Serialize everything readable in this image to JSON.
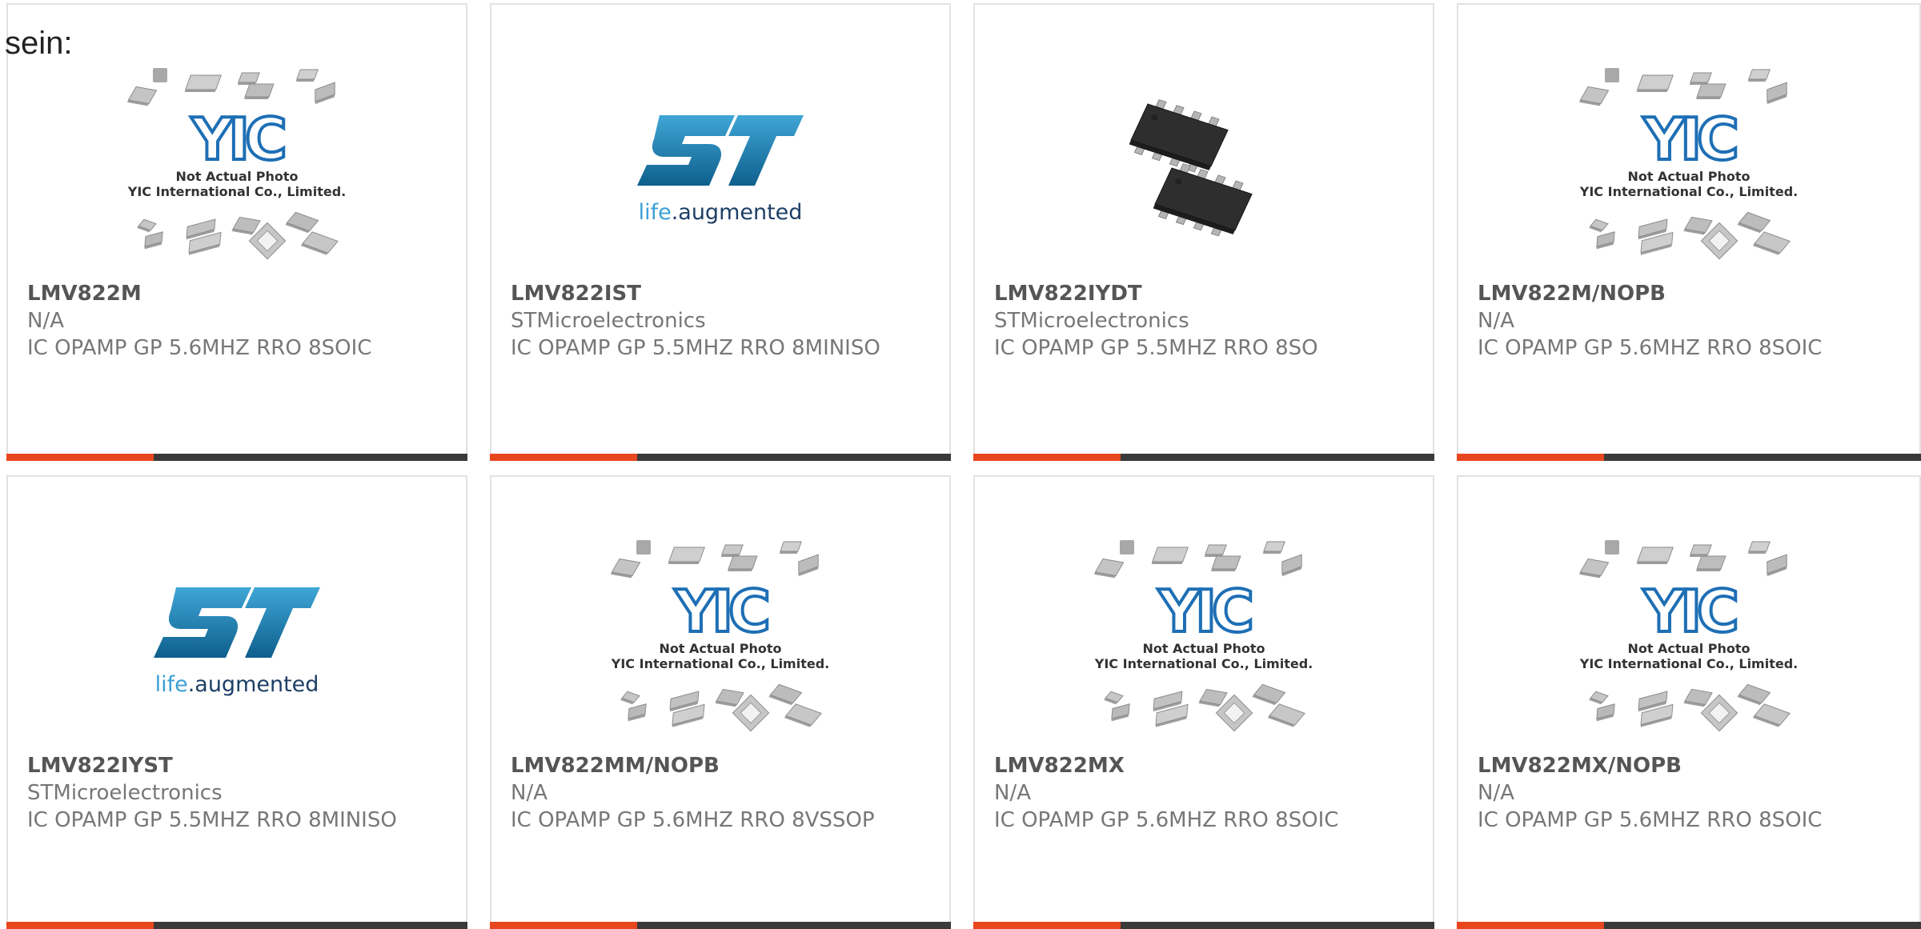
{
  "intro_text": "sein:",
  "products": [
    {
      "part": "LMV822M",
      "maker": "N/A",
      "desc": "IC OPAMP GP 5.6MHZ RRO 8SOIC",
      "image": "yic-placeholder"
    },
    {
      "part": "LMV822IST",
      "maker": "STMicroelectronics",
      "desc": "IC OPAMP GP 5.5MHZ RRO 8MINISO",
      "image": "st-logo"
    },
    {
      "part": "LMV822IYDT",
      "maker": "STMicroelectronics",
      "desc": "IC OPAMP GP 5.5MHZ RRO 8SO",
      "image": "chip-photo"
    },
    {
      "part": "LMV822M/NOPB",
      "maker": "N/A",
      "desc": "IC OPAMP GP 5.6MHZ RRO 8SOIC",
      "image": "yic-placeholder"
    },
    {
      "part": "LMV822IYST",
      "maker": "STMicroelectronics",
      "desc": "IC OPAMP GP 5.5MHZ RRO 8MINISO",
      "image": "st-logo"
    },
    {
      "part": "LMV822MM/NOPB",
      "maker": "N/A",
      "desc": "IC OPAMP GP 5.6MHZ RRO 8VSSOP",
      "image": "yic-placeholder"
    },
    {
      "part": "LMV822MX",
      "maker": "N/A",
      "desc": "IC OPAMP GP 5.6MHZ RRO 8SOIC",
      "image": "yic-placeholder"
    },
    {
      "part": "LMV822MX/NOPB",
      "maker": "N/A",
      "desc": "IC OPAMP GP 5.6MHZ RRO 8SOIC",
      "image": "yic-placeholder"
    }
  ],
  "placeholder": {
    "line1": "Not Actual Photo",
    "line2": "YIC International Co., Limited.",
    "logo_text": "YIC"
  },
  "st_logo": {
    "tagline_life": "life",
    "tagline_rest": ".augmented"
  },
  "colors": {
    "accent": "#e8461e",
    "bar_dark": "#3a3a3a",
    "st_blue": "#1f8cc0",
    "yic_blue": "#1e6fb5"
  }
}
